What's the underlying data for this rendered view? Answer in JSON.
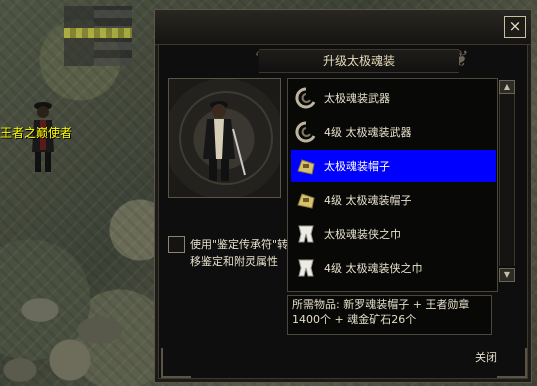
{
  "world": {
    "player_name": "王者之巅使者"
  },
  "dialog": {
    "title": "升级太极魂装",
    "close_x": "×",
    "close_label": "关闭",
    "checkbox_text": "使用\"鉴定传承符\"转移鉴定和附灵属性",
    "items": [
      {
        "label": "太极魂装武器",
        "icon": "weapon-ring-icon"
      },
      {
        "label": "4级 太极魂装武器",
        "icon": "weapon-ring-icon"
      },
      {
        "label": "太极魂装帽子",
        "icon": "hat-icon"
      },
      {
        "label": "4级 太极魂装帽子",
        "icon": "hat-icon"
      },
      {
        "label": "太极魂装侠之巾",
        "icon": "scarf-icon"
      },
      {
        "label": "4级 太极魂装侠之巾",
        "icon": "scarf-icon"
      }
    ],
    "selected_index": 2,
    "requirements": "所需物品: 新罗魂装帽子 + 王者勋章1400个 + 魂金矿石26个",
    "colors": {
      "selected_bg": "#0000ff",
      "title_text": "#e7dcb8",
      "player_name": "#ffff00"
    }
  }
}
